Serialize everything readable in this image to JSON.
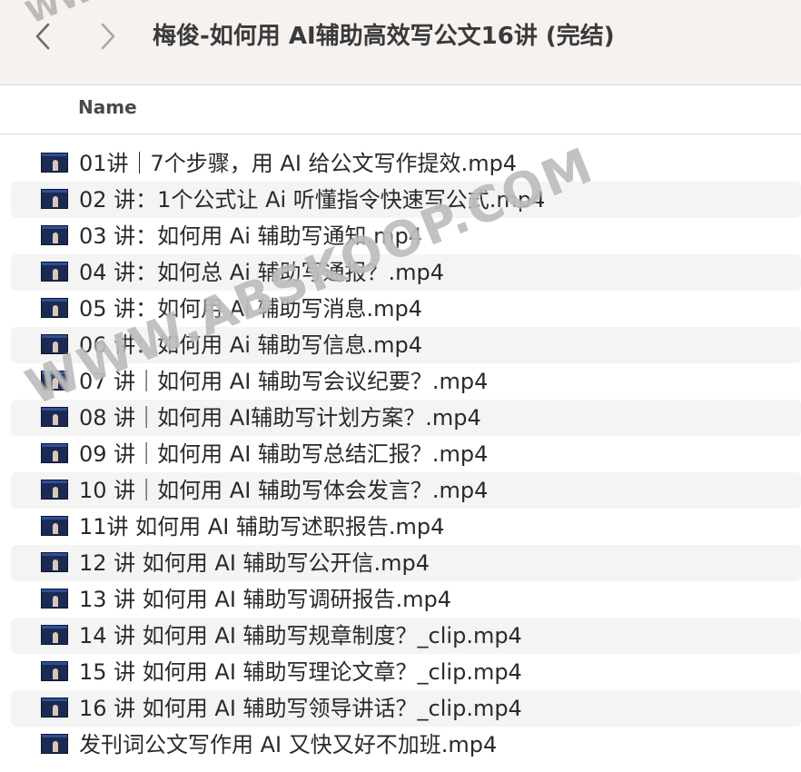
{
  "window": {
    "title": "梅俊-如何用 AI辅助高效写公文16讲 (完结)"
  },
  "toolbar": {
    "back_icon": "chevron-left-icon",
    "forward_icon": "chevron-right-icon"
  },
  "columns": {
    "name": "Name"
  },
  "files": [
    {
      "name": "01讲｜7个步骤，用 AI 给公文写作提效.mp4"
    },
    {
      "name": "02 讲：1个公式让 Ai 听懂指令快速写公式.mp4"
    },
    {
      "name": "03 讲：如何用 Ai 辅助写通知.mp4"
    },
    {
      "name": "04 讲：如何总 Ai 辅助写通报？.mp4"
    },
    {
      "name": "05 讲：如何用 Ai 辅助写消息.mp4"
    },
    {
      "name": "06 讲：如何用 Ai 辅助写信息.mp4"
    },
    {
      "name": "07 讲｜如何用 AI 辅助写会议纪要？.mp4"
    },
    {
      "name": "08 讲｜如何用 AI辅助写计划方案？.mp4"
    },
    {
      "name": "09 讲｜如何用 AI 辅助写总结汇报？.mp4"
    },
    {
      "name": "10 讲｜如何用 AI 辅助写体会发言？.mp4"
    },
    {
      "name": "11讲 如何用 AI 辅助写述职报告.mp4"
    },
    {
      "name": "12 讲 如何用 AI 辅助写公开信.mp4"
    },
    {
      "name": "13 讲 如何用 AI 辅助写调研报告.mp4"
    },
    {
      "name": "14 讲 如何用 AI 辅助写规章制度？_clip.mp4"
    },
    {
      "name": "15 讲 如何用 AI 辅助写理论文章？_clip.mp4"
    },
    {
      "name": "16 讲 如何用 AI 辅助写领导讲话？_clip.mp4"
    },
    {
      "name": "发刊词公文写作用 AI 又快又好不加班.mp4"
    }
  ],
  "watermark": {
    "text": "WWW.ABSKOOP.COM",
    "top_text": "WW"
  }
}
